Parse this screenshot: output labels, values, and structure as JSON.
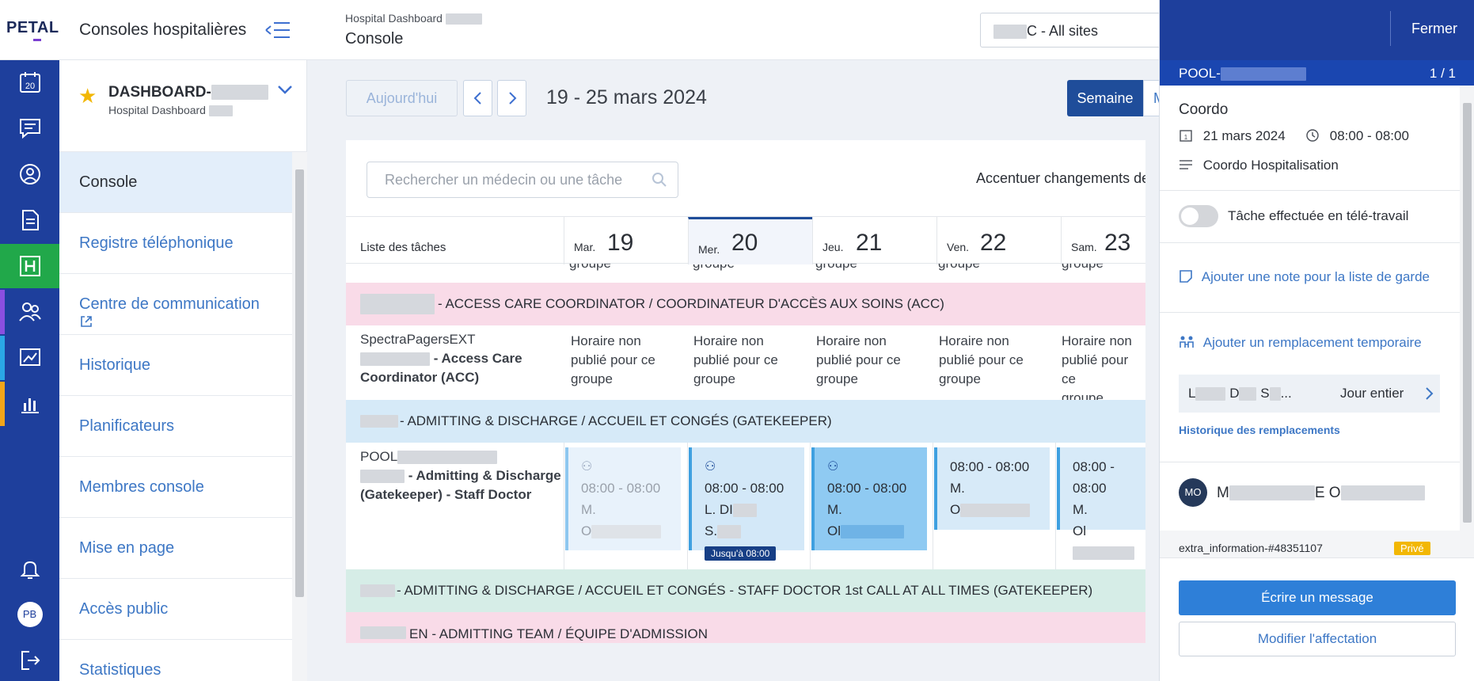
{
  "header": {
    "logo": "PETAL",
    "app_title": "Consoles hospitalières",
    "page_sub": "Hospital Dashboard",
    "page_title": "Console",
    "site_select": "C - All sites"
  },
  "rail": {
    "calendar_day": "20",
    "user_initials": "PB"
  },
  "dashboard": {
    "name": "DASHBOARD-",
    "sub": "Hospital Dashboard"
  },
  "nav": {
    "items": [
      {
        "label": "Console"
      },
      {
        "label": "Registre téléphonique"
      },
      {
        "label": "Centre de communication"
      },
      {
        "label": "Historique"
      },
      {
        "label": "Planificateurs"
      },
      {
        "label": "Membres console"
      },
      {
        "label": "Mise en page"
      },
      {
        "label": "Accès public"
      },
      {
        "label": "Statistiques"
      }
    ]
  },
  "toolbar": {
    "today": "Aujourd'hui",
    "date_range": "19 - 25 mars 2024",
    "week": "Semaine",
    "month": "M"
  },
  "schedule": {
    "search_placeholder": "Rechercher un médecin ou une tâche",
    "accent_label": "Accentuer changements depu",
    "tasks_label": "Liste des tâches",
    "days": [
      {
        "abbr": "Mar.",
        "num": "19"
      },
      {
        "abbr": "Mer.",
        "num": "20"
      },
      {
        "abbr": "Jeu.",
        "num": "21"
      },
      {
        "abbr": "Ven.",
        "num": "22"
      },
      {
        "abbr": "Sam.",
        "num": "23"
      }
    ],
    "group_word": "groupe",
    "group1": "- ACCESS CARE COORDINATOR / COORDINATEUR D'ACCÈS AUX SOINS (ACC)",
    "row1_line1": "SpectraPagersEXT",
    "row1_line2": "- Access Care",
    "row1_line3": "Coordinator (ACC)",
    "unpublished": [
      "Horaire non",
      "publié pour ce",
      "groupe"
    ],
    "group2": "- ADMITTING & DISCHARGE / ACCUEIL ET CONGÉS (GATEKEEPER)",
    "row2_line1": "POOL",
    "row2_line2": "- Admitting & Discharge",
    "row2_line3": "(Gatekeeper) - Staff Doctor",
    "shift_time": "08:00 - 08:00",
    "s1_name": "M.",
    "s1_last": "O",
    "s2_name": "L. DI",
    "s2_last": "S.",
    "s2_badge": "Jusqu'à 08:00",
    "s3_name": "M.",
    "s3_last": "Ol",
    "s4_name": "M.",
    "s4_last": "O",
    "s5_name": "M.",
    "s5_last": "Ol",
    "group3": "- ADMITTING & DISCHARGE / ACCUEIL ET CONGÉS - STAFF DOCTOR 1st CALL AT ALL TIMES (GATEKEEPER)",
    "group4": "EN - ADMITTING TEAM / ÉQUIPE D'ADMISSION"
  },
  "panel": {
    "close": "Fermer",
    "pool": "POOL-",
    "count": "1 / 1",
    "role": "Coordo",
    "date": "21 mars 2024",
    "time": "08:00 - 08:00",
    "desc": "Coordo Hospitalisation",
    "telework": "Tâche effectuée en télé-travail",
    "add_note": "Ajouter une note pour la liste de garde",
    "add_temp": "Ajouter un remplacement temporaire",
    "repl_name_a": "L",
    "repl_name_b": "D",
    "repl_name_c": "S",
    "repl_duration": "Jour entier",
    "history": "Historique des remplacements",
    "avatar": "MO",
    "person_a": "M",
    "person_b": "E O",
    "extra": "extra_information-#48351107",
    "prive": "Privé",
    "write": "Écrire un message",
    "edit": "Modifier l'affectation"
  },
  "colors": {
    "brand": "#1e3f9c",
    "accent": "#2e7fd8",
    "rail_active": "#21a84a"
  }
}
